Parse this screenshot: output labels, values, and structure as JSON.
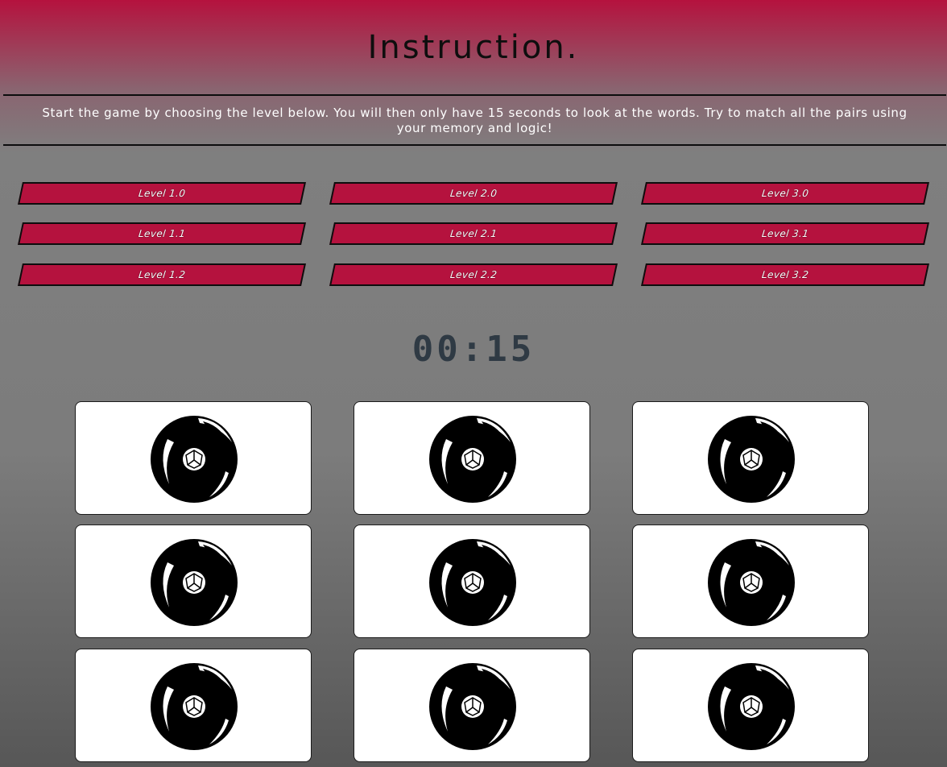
{
  "header": {
    "title": "Instruction.",
    "instruction": "Start the game by choosing the level below. You will then only have 15 seconds to look at the words. Try to match all the pairs using your memory and logic!"
  },
  "levels": [
    {
      "label": "Level 1.0"
    },
    {
      "label": "Level 2.0"
    },
    {
      "label": "Level 3.0"
    },
    {
      "label": "Level 1.1"
    },
    {
      "label": "Level 2.1"
    },
    {
      "label": "Level 3.1"
    },
    {
      "label": "Level 1.2"
    },
    {
      "label": "Level 2.2"
    },
    {
      "label": "Level 3.2"
    }
  ],
  "timer": {
    "value": "00:15"
  },
  "cards": [
    {
      "icon": "card-back-emblem-icon"
    },
    {
      "icon": "card-back-emblem-icon"
    },
    {
      "icon": "card-back-emblem-icon"
    },
    {
      "icon": "card-back-emblem-icon"
    },
    {
      "icon": "card-back-emblem-icon"
    },
    {
      "icon": "card-back-emblem-icon"
    },
    {
      "icon": "card-back-emblem-icon"
    },
    {
      "icon": "card-back-emblem-icon"
    },
    {
      "icon": "card-back-emblem-icon"
    }
  ],
  "colors": {
    "accent": "#b5123e",
    "timer": "#2f3a44",
    "card": "#ffffff"
  }
}
